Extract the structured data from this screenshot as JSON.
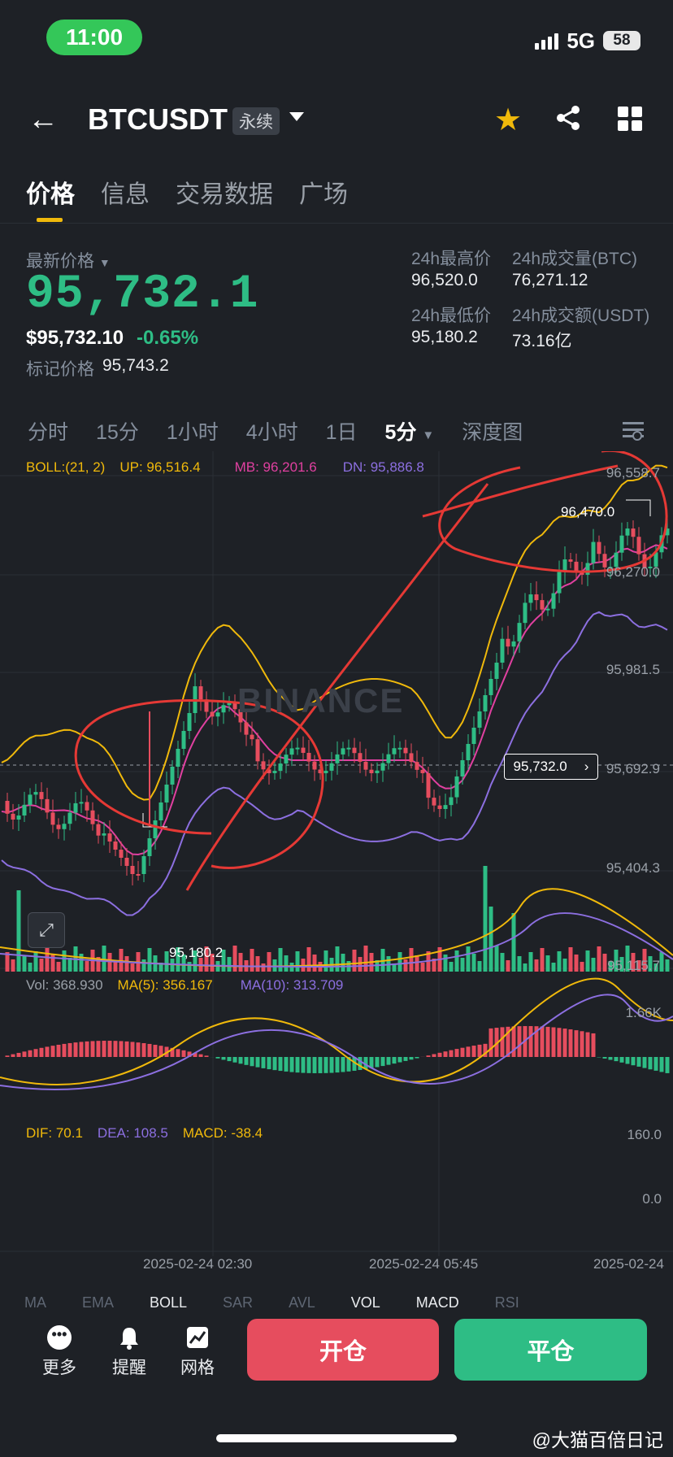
{
  "status": {
    "time": "11:00",
    "network": "5G",
    "battery": "58"
  },
  "header": {
    "symbol": "BTCUSDT",
    "tag": "永续"
  },
  "tabs": [
    "价格",
    "信息",
    "交易数据",
    "广场"
  ],
  "price": {
    "last_label": "最新价格",
    "last": "95,732.1",
    "usd": "$95,732.10",
    "change": "-0.65%",
    "mark_label": "标记价格",
    "mark": "95,743.2",
    "high_label": "24h最高价",
    "high": "96,520.0",
    "low_label": "24h最低价",
    "low": "95,180.2",
    "vol_btc_label": "24h成交量(BTC)",
    "vol_btc": "76,271.12",
    "vol_usdt_label": "24h成交额(USDT)",
    "vol_usdt": "73.16亿"
  },
  "intervals": [
    "分时",
    "15分",
    "1小时",
    "4小时",
    "1日",
    "5分",
    "深度图"
  ],
  "boll": {
    "label": "BOLL:(21, 2)",
    "up": "UP: 96,516.4",
    "mb": "MB: 96,201.6",
    "dn": "DN: 95,886.8"
  },
  "vol": {
    "vol": "Vol: 368.930",
    "ma5": "MA(5): 356.167",
    "ma10": "MA(10): 313.709",
    "max": "1.66K"
  },
  "macd": {
    "dif": "DIF: 70.1",
    "dea": "DEA: 108.5",
    "macd": "MACD: -38.4",
    "top": "160.0",
    "zero": "0.0"
  },
  "brand_watermark": "BINANCE",
  "chart_data": {
    "type": "candlestick",
    "price_axis": [
      "96,558.7",
      "96,270.0",
      "95,981.5",
      "95,692.9",
      "95,404.3",
      "95,115.7"
    ],
    "ylim": [
      95115.7,
      96558.7
    ],
    "time_labels": [
      "2025-02-24 02:30",
      "2025-02-24 05:45",
      "2025-02-24"
    ],
    "high_marker": "96,470.0",
    "low_marker": "95,180.2",
    "current_price_tag": "95,732.0"
  },
  "bottom_indicators": [
    "MA",
    "EMA",
    "BOLL",
    "SAR",
    "AVL",
    "VOL",
    "MACD",
    "RSI"
  ],
  "nav": {
    "more": "更多",
    "alert": "提醒",
    "grid": "网格",
    "open": "开仓",
    "close": "平仓"
  },
  "watermark": "@大猫百倍日记",
  "colors": {
    "up": "#2ebd85",
    "down": "#e64d5e",
    "accent": "#f0b90b",
    "mb": "#e040a0",
    "dn": "#8c6fe0",
    "ma5": "#f0b90b"
  }
}
